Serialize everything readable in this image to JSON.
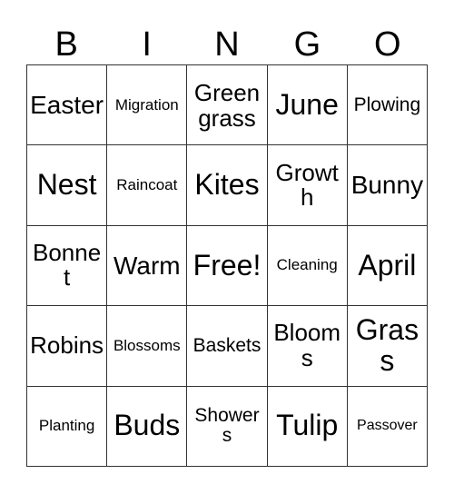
{
  "card": {
    "title": "Bingo Card",
    "background_color": "#ffffff",
    "text_color": "#000000",
    "border_color": "#333333",
    "columns": 5,
    "rows": 5
  },
  "header": {
    "letters": [
      "B",
      "I",
      "N",
      "G",
      "O"
    ]
  },
  "grid": {
    "rows": [
      {
        "cells": [
          {
            "text": "Easter",
            "size": "lg"
          },
          {
            "text": "Migration",
            "size": "xs"
          },
          {
            "text": "Green grass",
            "size": "wrap2"
          },
          {
            "text": "June",
            "size": "xl"
          },
          {
            "text": "Plowing",
            "size": "sm"
          }
        ]
      },
      {
        "cells": [
          {
            "text": "Nest",
            "size": "xl"
          },
          {
            "text": "Raincoat",
            "size": "xs"
          },
          {
            "text": "Kites",
            "size": "xl"
          },
          {
            "text": "Growth",
            "size": "md"
          },
          {
            "text": "Bunny",
            "size": "lg"
          }
        ]
      },
      {
        "cells": [
          {
            "text": "Bonnet",
            "size": "md"
          },
          {
            "text": "Warm",
            "size": "lg"
          },
          {
            "text": "Free!",
            "size": "xl"
          },
          {
            "text": "Cleaning",
            "size": "xs"
          },
          {
            "text": "April",
            "size": "xl"
          }
        ]
      },
      {
        "cells": [
          {
            "text": "Robins",
            "size": "md"
          },
          {
            "text": "Blossoms",
            "size": "xs"
          },
          {
            "text": "Baskets",
            "size": "sm"
          },
          {
            "text": "Blooms",
            "size": "md"
          },
          {
            "text": "Grass",
            "size": "xl"
          }
        ]
      },
      {
        "cells": [
          {
            "text": "Planting",
            "size": "xs"
          },
          {
            "text": "Buds",
            "size": "xl"
          },
          {
            "text": "Showers",
            "size": "sm"
          },
          {
            "text": "Tulip",
            "size": "xl"
          },
          {
            "text": "Passover",
            "size": "xxs"
          }
        ]
      }
    ]
  },
  "free_space": {
    "label": "Free!",
    "row": 3,
    "column": 3
  }
}
